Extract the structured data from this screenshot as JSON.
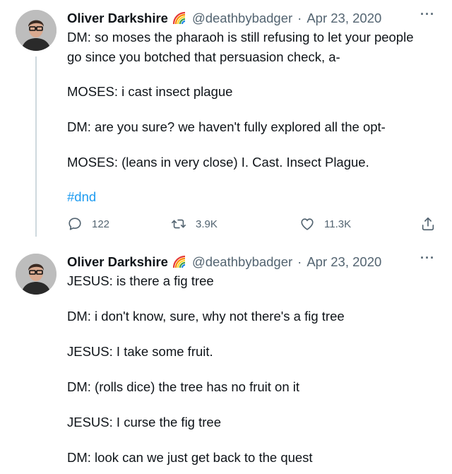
{
  "tweets": [
    {
      "author_name": "Oliver Darkshire",
      "flair_icon": "rainbow-icon",
      "handle": "@deathbybadger",
      "separator": "·",
      "date": "Apr 23, 2020",
      "more": "···",
      "lines": [
        "DM: so moses the pharaoh is still refusing to let your people",
        "go since you botched that persuasion check, a-",
        "MOSES: i cast insect plague",
        "DM: are you sure? we haven't fully explored all the opt-",
        "MOSES: (leans in very close) I. Cast. Insect Plague.",
        "#dnd"
      ],
      "actions": {
        "replies": "122",
        "retweets": "3.9K",
        "likes": "11.3K"
      }
    },
    {
      "author_name": "Oliver Darkshire",
      "flair_icon": "rainbow-icon",
      "handle": "@deathbybadger",
      "separator": "·",
      "date": "Apr 23, 2020",
      "more": "···",
      "lines": [
        "JESUS: is there a fig tree",
        "DM: i don't know, sure, why not there's a fig tree",
        "JESUS: I take some fruit.",
        "DM: (rolls dice) the tree has no fruit on it",
        "JESUS: I curse the fig tree",
        "DM: look can we just get back to the quest"
      ]
    }
  ],
  "colors": {
    "text": "#0f1419",
    "secondary": "#536471",
    "link": "#1d9bf0",
    "thread_line": "#cfd9de"
  }
}
